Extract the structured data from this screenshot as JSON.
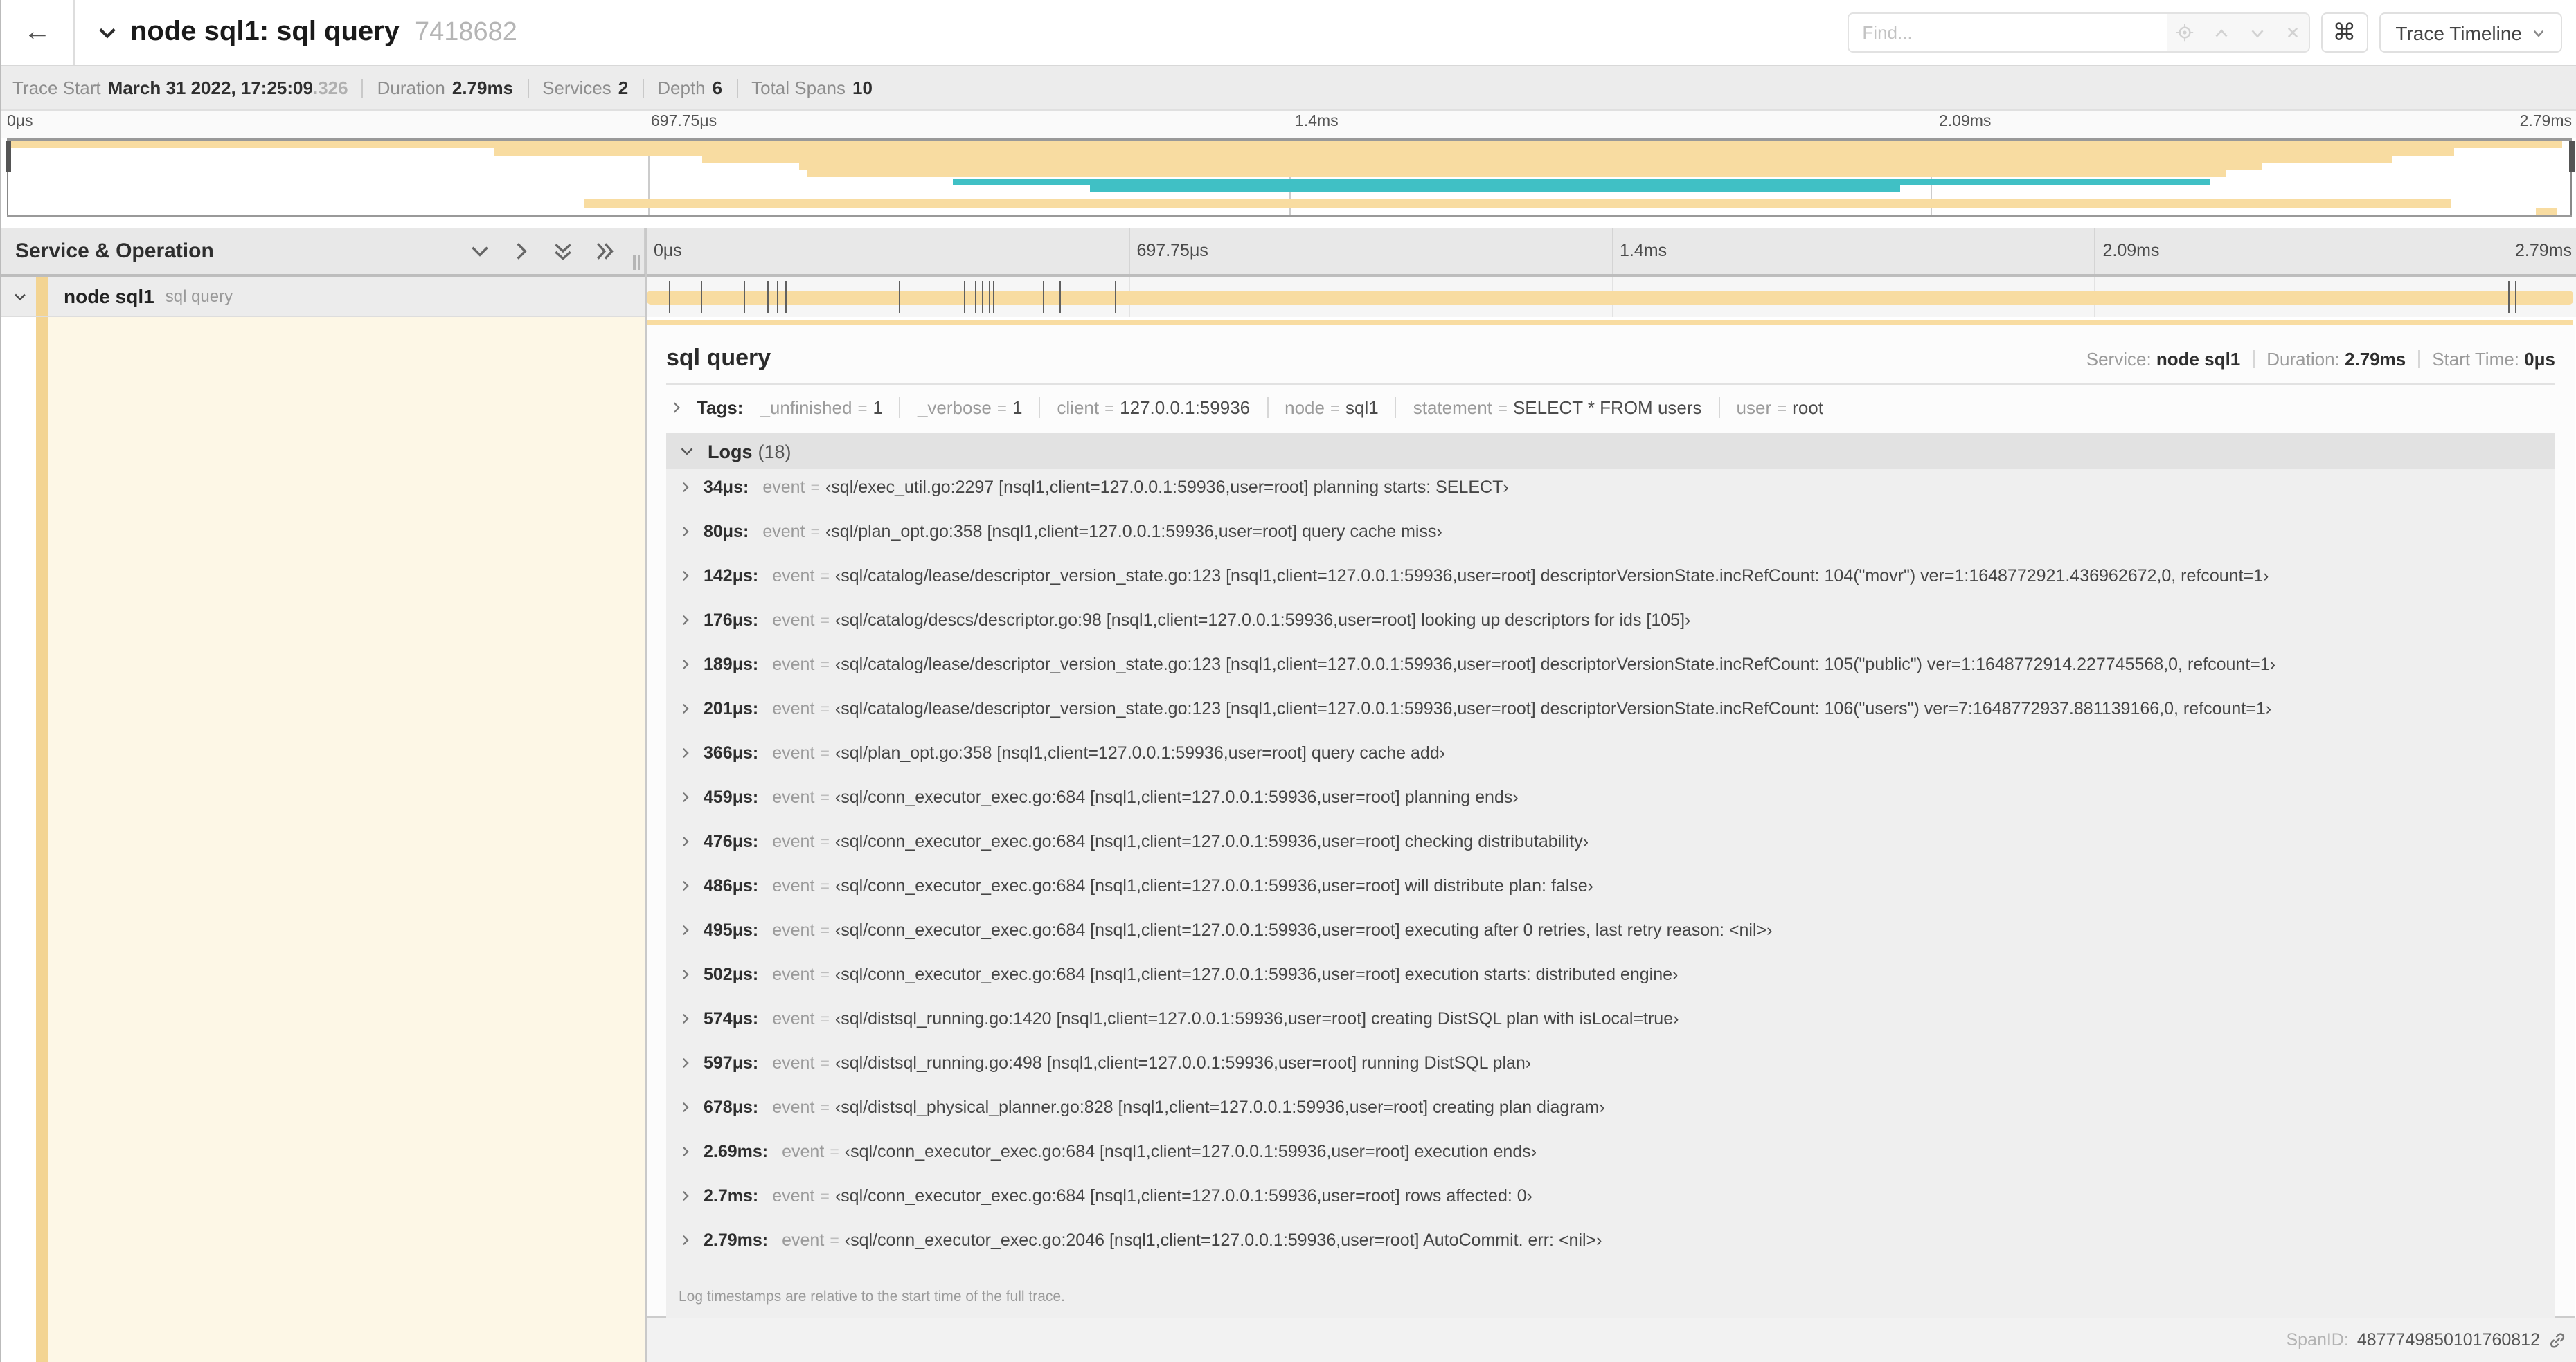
{
  "colors": {
    "khaki": "#f8dca1",
    "khaki_dark": "#f3d famous",
    "teal": "#40c0c5",
    "cream": "#fdf7e6",
    "strip": "#f3d492"
  },
  "header": {
    "back_arrow": "←",
    "trace_name": "node sql1: sql query",
    "trace_id": "7418682",
    "find_placeholder": "Find...",
    "shortcut_button": "⌘",
    "view_button": "Trace Timeline"
  },
  "summary": {
    "items": [
      {
        "label": "Trace Start",
        "value": "March 31 2022, 17:25:09",
        "muted": ".326"
      },
      {
        "label": "Duration",
        "value": "2.79ms",
        "muted": ""
      },
      {
        "label": "Services",
        "value": "2",
        "muted": ""
      },
      {
        "label": "Depth",
        "value": "6",
        "muted": ""
      },
      {
        "label": "Total Spans",
        "value": "10",
        "muted": ""
      }
    ]
  },
  "timeline": {
    "duration_us": 2790,
    "ticks": [
      "0μs",
      "697.75μs",
      "1.4ms",
      "2.09ms",
      "2.79ms"
    ],
    "tick_pcts": [
      0,
      25,
      50,
      75,
      100
    ]
  },
  "minimap": {
    "spans": [
      {
        "row": 0,
        "start_pct": 0,
        "end_pct": 99.6,
        "color": "khaki"
      },
      {
        "row": 1,
        "start_pct": 19.0,
        "end_pct": 95.4,
        "color": "khaki"
      },
      {
        "row": 2,
        "start_pct": 27.1,
        "end_pct": 93.0,
        "color": "khaki"
      },
      {
        "row": 3,
        "start_pct": 30.9,
        "end_pct": 87.9,
        "color": "khaki"
      },
      {
        "row": 4,
        "start_pct": 31.2,
        "end_pct": 86.5,
        "color": "khaki"
      },
      {
        "row": 5,
        "start_pct": 36.9,
        "end_pct": 85.9,
        "color": "teal"
      },
      {
        "row": 6,
        "start_pct": 42.2,
        "end_pct": 73.8,
        "color": "teal"
      },
      {
        "row": 8,
        "start_pct": 22.5,
        "end_pct": 95.3,
        "color": "khaki"
      },
      {
        "row": 9,
        "start_pct": 98.6,
        "end_pct": 99.4,
        "color": "khaki"
      }
    ],
    "rows": 10
  },
  "left_panel": {
    "title": "Service & Operation",
    "row": {
      "service": "node sql1",
      "operation": "sql query"
    }
  },
  "detail": {
    "title": "sql query",
    "meta": [
      {
        "label": "Service:",
        "value": "node sql1"
      },
      {
        "label": "Duration:",
        "value": "2.79ms"
      },
      {
        "label": "Start Time:",
        "value": "0μs"
      }
    ],
    "tags_label": "Tags:",
    "tags": [
      {
        "key": "_unfinished",
        "value": "1"
      },
      {
        "key": "_verbose",
        "value": "1"
      },
      {
        "key": "client",
        "value": "127.0.0.1:59936"
      },
      {
        "key": "node",
        "value": "sql1"
      },
      {
        "key": "statement",
        "value": "SELECT * FROM users"
      },
      {
        "key": "user",
        "value": "root"
      }
    ],
    "logs_label": "Logs",
    "logs_count": "(18)",
    "log_field": "event",
    "logs": [
      {
        "t": "34μs",
        "t_us": 34,
        "msg": "‹sql/exec_util.go:2297 [nsql1,client=127.0.0.1:59936,user=root] planning starts: SELECT›"
      },
      {
        "t": "80μs",
        "t_us": 80,
        "msg": "‹sql/plan_opt.go:358 [nsql1,client=127.0.0.1:59936,user=root] query cache miss›"
      },
      {
        "t": "142μs",
        "t_us": 142,
        "msg": "‹sql/catalog/lease/descriptor_version_state.go:123 [nsql1,client=127.0.0.1:59936,user=root] descriptorVersionState.incRefCount: 104(\"movr\") ver=1:1648772921.436962672,0, refcount=1›"
      },
      {
        "t": "176μs",
        "t_us": 176,
        "msg": "‹sql/catalog/descs/descriptor.go:98 [nsql1,client=127.0.0.1:59936,user=root] looking up descriptors for ids [105]›"
      },
      {
        "t": "189μs",
        "t_us": 189,
        "msg": "‹sql/catalog/lease/descriptor_version_state.go:123 [nsql1,client=127.0.0.1:59936,user=root] descriptorVersionState.incRefCount: 105(\"public\") ver=1:1648772914.227745568,0, refcount=1›"
      },
      {
        "t": "201μs",
        "t_us": 201,
        "msg": "‹sql/catalog/lease/descriptor_version_state.go:123 [nsql1,client=127.0.0.1:59936,user=root] descriptorVersionState.incRefCount: 106(\"users\") ver=7:1648772937.881139166,0, refcount=1›"
      },
      {
        "t": "366μs",
        "t_us": 366,
        "msg": "‹sql/plan_opt.go:358 [nsql1,client=127.0.0.1:59936,user=root] query cache add›"
      },
      {
        "t": "459μs",
        "t_us": 459,
        "msg": "‹sql/conn_executor_exec.go:684 [nsql1,client=127.0.0.1:59936,user=root] planning ends›"
      },
      {
        "t": "476μs",
        "t_us": 476,
        "msg": "‹sql/conn_executor_exec.go:684 [nsql1,client=127.0.0.1:59936,user=root] checking distributability›"
      },
      {
        "t": "486μs",
        "t_us": 486,
        "msg": "‹sql/conn_executor_exec.go:684 [nsql1,client=127.0.0.1:59936,user=root] will distribute plan: false›"
      },
      {
        "t": "495μs",
        "t_us": 495,
        "msg": "‹sql/conn_executor_exec.go:684 [nsql1,client=127.0.0.1:59936,user=root] executing after 0 retries, last retry reason: <nil>›"
      },
      {
        "t": "502μs",
        "t_us": 502,
        "msg": "‹sql/conn_executor_exec.go:684 [nsql1,client=127.0.0.1:59936,user=root] execution starts: distributed engine›"
      },
      {
        "t": "574μs",
        "t_us": 574,
        "msg": "‹sql/distsql_running.go:1420 [nsql1,client=127.0.0.1:59936,user=root] creating DistSQL plan with isLocal=true›"
      },
      {
        "t": "597μs",
        "t_us": 597,
        "msg": "‹sql/distsql_running.go:498 [nsql1,client=127.0.0.1:59936,user=root] running DistSQL plan›"
      },
      {
        "t": "678μs",
        "t_us": 678,
        "msg": "‹sql/distsql_physical_planner.go:828 [nsql1,client=127.0.0.1:59936,user=root] creating plan diagram›"
      },
      {
        "t": "2.69ms",
        "t_us": 2690,
        "msg": "‹sql/conn_executor_exec.go:684 [nsql1,client=127.0.0.1:59936,user=root] execution ends›"
      },
      {
        "t": "2.7ms",
        "t_us": 2700,
        "msg": "‹sql/conn_executor_exec.go:684 [nsql1,client=127.0.0.1:59936,user=root] rows affected: 0›"
      },
      {
        "t": "2.79ms",
        "t_us": 2790,
        "msg": "‹sql/conn_executor_exec.go:2046 [nsql1,client=127.0.0.1:59936,user=root] AutoCommit. err: <nil>›"
      }
    ],
    "note": "Log timestamps are relative to the start time of the full trace."
  },
  "footer": {
    "spanid_label": "SpanID:",
    "spanid_value": "4877749850101760812"
  }
}
